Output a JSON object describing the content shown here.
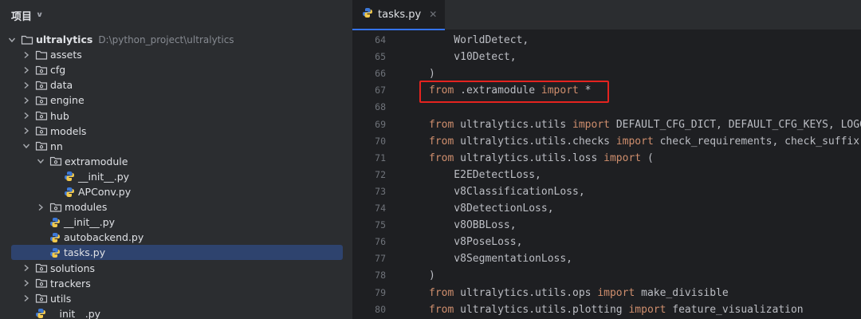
{
  "project_panel": {
    "title": "项目",
    "tree": [
      {
        "label": "ultralytics",
        "hint": "D:\\python_project\\ultralytics",
        "kind": "folder",
        "expanded": true,
        "bold": true
      },
      {
        "label": "assets",
        "kind": "folder",
        "expanded": false
      },
      {
        "label": "cfg",
        "kind": "package",
        "expanded": false
      },
      {
        "label": "data",
        "kind": "package",
        "expanded": false
      },
      {
        "label": "engine",
        "kind": "package",
        "expanded": false
      },
      {
        "label": "hub",
        "kind": "package",
        "expanded": false
      },
      {
        "label": "models",
        "kind": "package",
        "expanded": false
      },
      {
        "label": "nn",
        "kind": "package",
        "expanded": true
      },
      {
        "label": "extramodule",
        "kind": "package",
        "expanded": true
      },
      {
        "label": "__init__.py",
        "kind": "python"
      },
      {
        "label": "APConv.py",
        "kind": "python"
      },
      {
        "label": "modules",
        "kind": "package",
        "expanded": false
      },
      {
        "label": "__init__.py",
        "kind": "python"
      },
      {
        "label": "autobackend.py",
        "kind": "python"
      },
      {
        "label": "tasks.py",
        "kind": "python",
        "selected": true
      },
      {
        "label": "solutions",
        "kind": "package",
        "expanded": false
      },
      {
        "label": "trackers",
        "kind": "package",
        "expanded": false
      },
      {
        "label": "utils",
        "kind": "package",
        "expanded": false
      },
      {
        "label": "__init__.py",
        "kind": "python"
      }
    ]
  },
  "editor": {
    "tab_label": "tasks.py",
    "lines": [
      {
        "num": "64",
        "text": "    WorldDetect,"
      },
      {
        "num": "65",
        "text": "    v10Detect,"
      },
      {
        "num": "66",
        "text": ")"
      },
      {
        "num": "67",
        "text": "from .extramodule import *"
      },
      {
        "num": "68",
        "text": ""
      },
      {
        "num": "69",
        "text": "from ultralytics.utils import DEFAULT_CFG_DICT, DEFAULT_CFG_KEYS, LOGGE"
      },
      {
        "num": "70",
        "text": "from ultralytics.utils.checks import check_requirements, check_suffix,"
      },
      {
        "num": "71",
        "text": "from ultralytics.utils.loss import ("
      },
      {
        "num": "72",
        "text": "    E2EDetectLoss,"
      },
      {
        "num": "73",
        "text": "    v8ClassificationLoss,"
      },
      {
        "num": "74",
        "text": "    v8DetectionLoss,"
      },
      {
        "num": "75",
        "text": "    v8OBBLoss,"
      },
      {
        "num": "76",
        "text": "    v8PoseLoss,"
      },
      {
        "num": "77",
        "text": "    v8SegmentationLoss,"
      },
      {
        "num": "78",
        "text": ")"
      },
      {
        "num": "79",
        "text": "from ultralytics.utils.ops import make_divisible"
      },
      {
        "num": "80",
        "text": "from ultralytics.utils.plotting import feature_visualization"
      }
    ]
  },
  "colors": {
    "keyword": "#cf8e6d",
    "text": "#bcbec4",
    "highlight_box": "#e5231f",
    "selection": "#2e436e"
  }
}
